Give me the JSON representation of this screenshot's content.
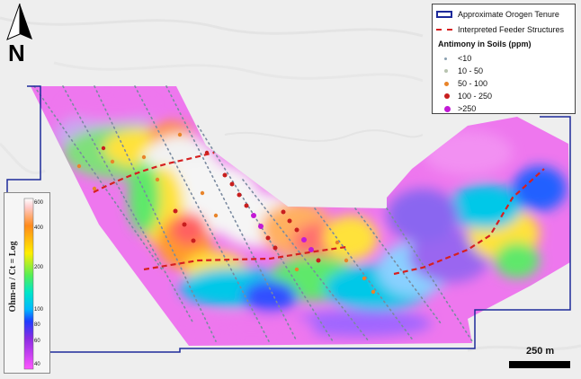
{
  "legend": {
    "tenure_label": "Approximate Orogen Tenure",
    "feeder_label": "Interpreted Feeder Structures",
    "antimony_title": "Antimony in Soils (ppm)",
    "classes": [
      {
        "label": "<10",
        "color": "#8aa0b0"
      },
      {
        "label": "10 - 50",
        "color": "#b8c4b0"
      },
      {
        "label": "50 - 100",
        "color": "#e8842a"
      },
      {
        "label": "100 - 250",
        "color": "#c81e1e"
      },
      {
        "label": ">250",
        "color": "#c21ad6"
      }
    ]
  },
  "colorbar": {
    "title": "Ohm-m / Ct = Log",
    "ticks": [
      "600",
      "400",
      "200",
      "100",
      "80",
      "60",
      "40"
    ]
  },
  "scale": {
    "label": "250 m"
  },
  "north": {
    "letter": "N"
  },
  "colors": {
    "tenure": "#1d2a9a",
    "feeder": "#d62020"
  }
}
